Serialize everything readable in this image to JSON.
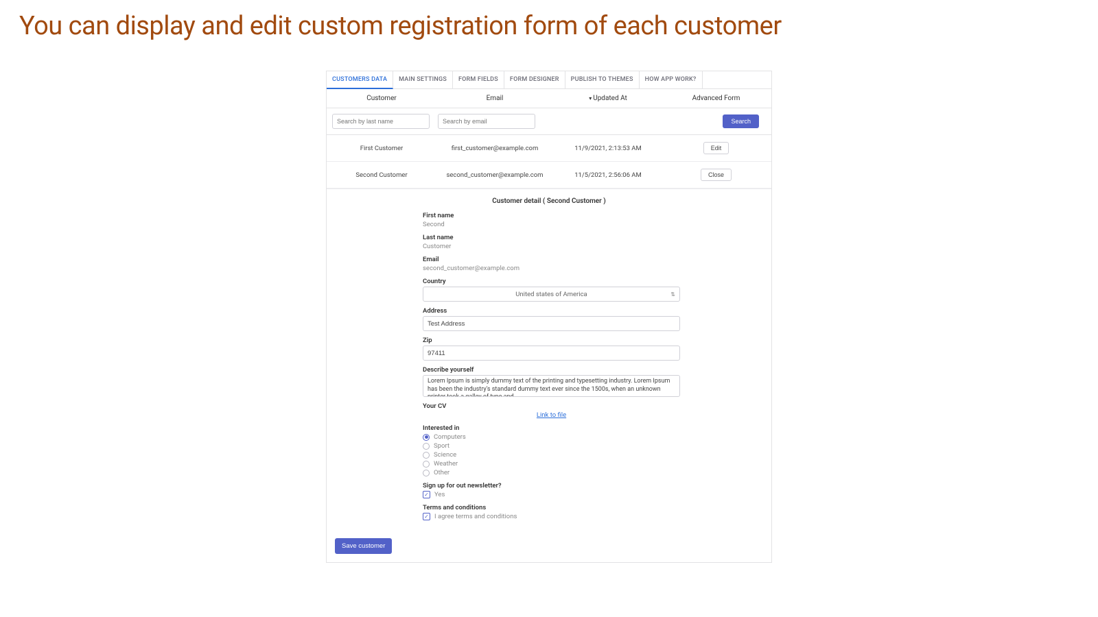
{
  "headline": "You can display and edit custom registration form of each customer",
  "tabs": [
    "CUSTOMERS DATA",
    "MAIN SETTINGS",
    "FORM FIELDS",
    "FORM DESIGNER",
    "PUBLISH TO THEMES",
    "HOW APP WORK?"
  ],
  "active_tab_index": 0,
  "columns": {
    "customer": "Customer",
    "email": "Email",
    "updated": "Updated At",
    "advanced": "Advanced Form",
    "sort_indicator": "▾"
  },
  "search": {
    "name_ph": "Search by last name",
    "email_ph": "Search by email",
    "button": "Search"
  },
  "rows": [
    {
      "name": "First Customer",
      "email": "first_customer@example.com",
      "updated": "11/9/2021, 2:13:53 AM",
      "action": "Edit"
    },
    {
      "name": "Second Customer",
      "email": "second_customer@example.com",
      "updated": "11/5/2021, 2:56:06 AM",
      "action": "Close"
    }
  ],
  "detail": {
    "title": "Customer detail ( Second Customer )",
    "first_name": {
      "label": "First name",
      "value": "Second"
    },
    "last_name": {
      "label": "Last name",
      "value": "Customer"
    },
    "email": {
      "label": "Email",
      "value": "second_customer@example.com"
    },
    "country": {
      "label": "Country",
      "value": "United states of America"
    },
    "address": {
      "label": "Address",
      "value": "Test Address"
    },
    "zip": {
      "label": "Zip",
      "value": "97411"
    },
    "describe": {
      "label": "Describe yourself",
      "value": "Lorem Ipsum is simply dummy text of the printing and typesetting industry. Lorem Ipsum has been the industry's standard dummy text ever since the 1500s, when an unknown printer took a galley of type and"
    },
    "cv": {
      "label": "Your CV",
      "link_text": "Link to file"
    },
    "interested": {
      "label": "Interested in",
      "options": [
        "Computers",
        "Sport",
        "Science",
        "Weather",
        "Other"
      ],
      "selected": "Computers"
    },
    "newsletter": {
      "label": "Sign up for out newsletter?",
      "option": "Yes",
      "checked": true
    },
    "terms": {
      "label": "Terms and conditions",
      "option": "I agree terms and conditions",
      "checked": true
    }
  },
  "save_button": "Save customer"
}
